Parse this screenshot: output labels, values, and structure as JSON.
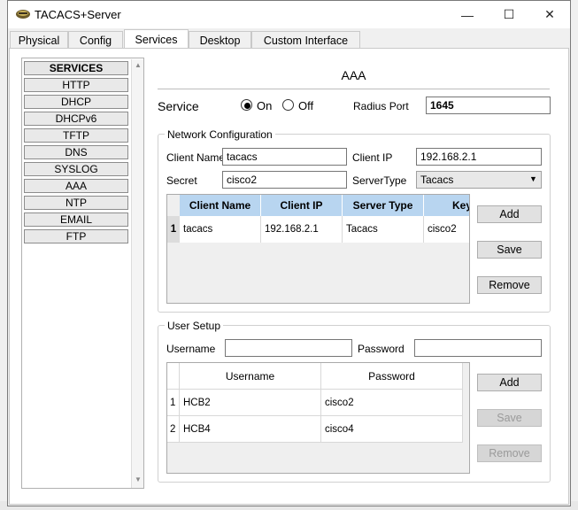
{
  "window": {
    "title": "TACACS+Server",
    "minimize": "—",
    "maximize": "☐",
    "close": "✕"
  },
  "tabs": [
    {
      "label": "Physical"
    },
    {
      "label": "Config"
    },
    {
      "label": "Services"
    },
    {
      "label": "Desktop"
    },
    {
      "label": "Custom Interface"
    }
  ],
  "services": {
    "header": "SERVICES",
    "items": [
      "HTTP",
      "DHCP",
      "DHCPv6",
      "TFTP",
      "DNS",
      "SYSLOG",
      "AAA",
      "NTP",
      "EMAIL",
      "FTP"
    ]
  },
  "aaa": {
    "title": "AAA",
    "service_label": "Service",
    "on_label": "On",
    "off_label": "Off",
    "radius_port_label": "Radius Port",
    "radius_port_value": "1645"
  },
  "network": {
    "legend": "Network Configuration",
    "client_name_label": "Client Name",
    "client_name_value": "tacacs",
    "client_ip_label": "Client IP",
    "client_ip_value": "192.168.2.1",
    "secret_label": "Secret",
    "secret_value": "cisco2",
    "server_type_label": "ServerType",
    "server_type_value": "Tacacs",
    "columns": [
      "Client Name",
      "Client IP",
      "Server Type",
      "Key"
    ],
    "rows": [
      {
        "num": "1",
        "client_name": "tacacs",
        "client_ip": "192.168.2.1",
        "server_type": "Tacacs",
        "key": "cisco2"
      }
    ],
    "add": "Add",
    "save": "Save",
    "remove": "Remove"
  },
  "users": {
    "legend": "User Setup",
    "username_label": "Username",
    "password_label": "Password",
    "columns": [
      "Username",
      "Password"
    ],
    "rows": [
      {
        "num": "1",
        "username": "HCB2",
        "password": "cisco2"
      },
      {
        "num": "2",
        "username": "HCB4",
        "password": "cisco4"
      }
    ],
    "add": "Add",
    "save": "Save",
    "remove": "Remove"
  }
}
